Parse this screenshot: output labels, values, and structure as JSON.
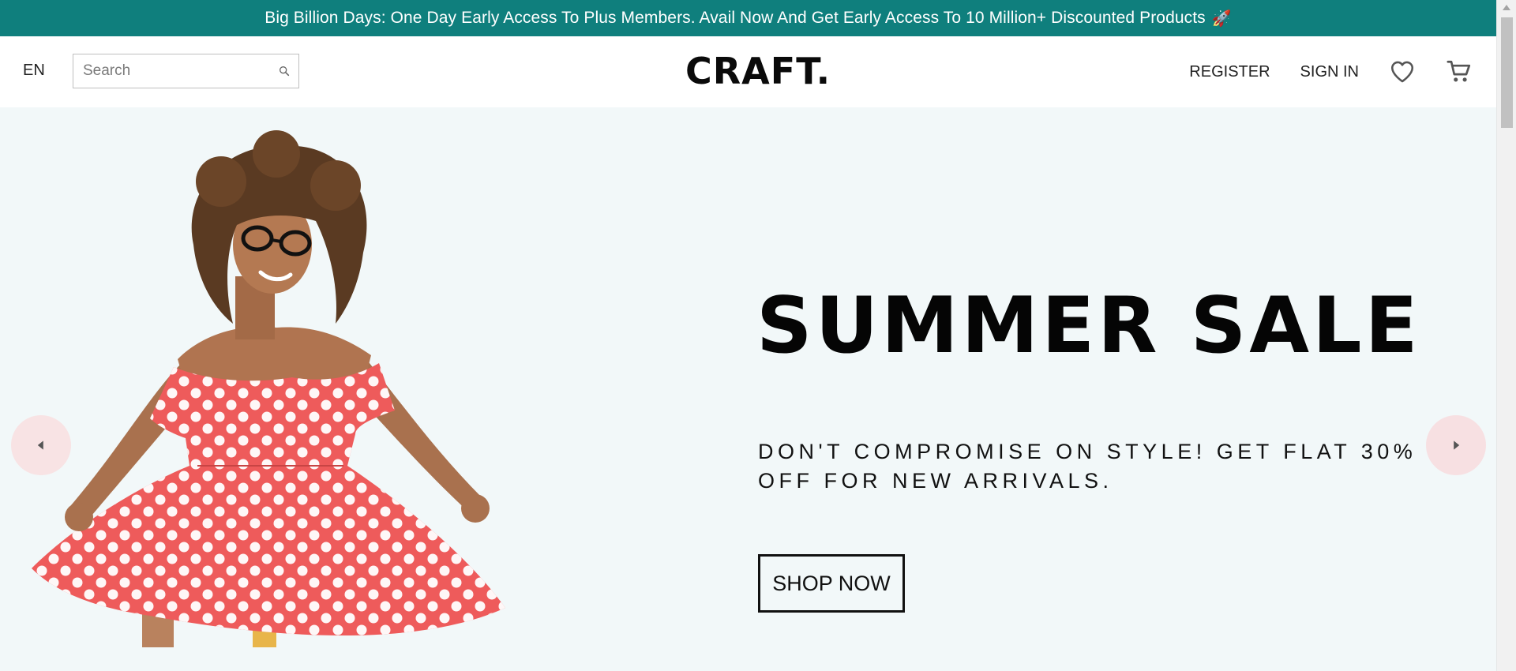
{
  "announcement": {
    "text": "Big Billion Days: One Day Early Access To Plus Members. Avail Now And Get Early Access To 10 Million+ Discounted Products",
    "emoji": "🚀"
  },
  "navbar": {
    "language": "EN",
    "search_placeholder": "Search",
    "logo": "CRAFT.",
    "register_label": "REGISTER",
    "signin_label": "SIGN IN",
    "icons": [
      "search-icon",
      "heart-icon",
      "cart-icon"
    ]
  },
  "hero": {
    "headline": "SUMMER SALE",
    "subline": "DON'T COMPROMISE ON STYLE! GET FLAT 30% OFF FOR NEW ARRIVALS.",
    "cta_label": "SHOP NOW",
    "icons": [
      "chevron-left-icon",
      "chevron-right-icon"
    ],
    "colors": {
      "announcement_bg": "#0f7f7d",
      "hero_bg": "#f2f8f9",
      "dress": "#ee5b5b",
      "arrow_bg": "#f8e3e4"
    }
  }
}
